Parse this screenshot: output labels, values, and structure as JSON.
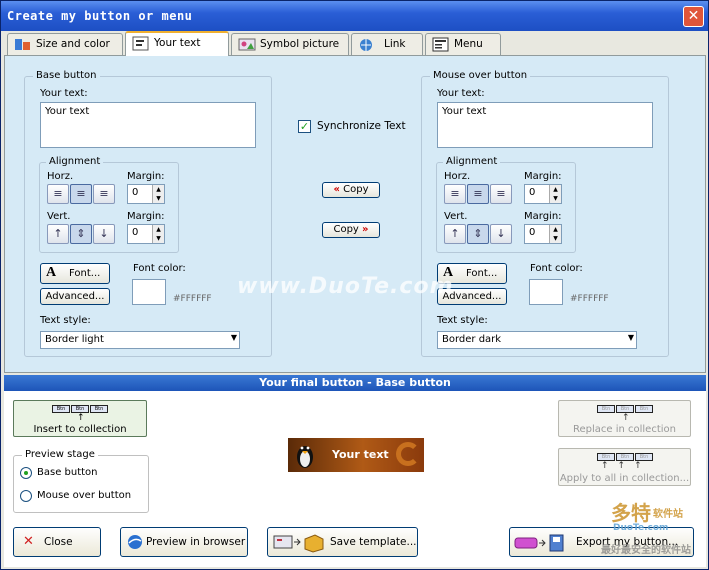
{
  "window": {
    "title": "Create my button or menu",
    "close": "✕"
  },
  "tabs": [
    {
      "label": "Size and color",
      "icon": "size-color-icon"
    },
    {
      "label": "Your text",
      "icon": "text-icon",
      "active": true
    },
    {
      "label": "Symbol picture",
      "icon": "picture-icon"
    },
    {
      "label": "Link",
      "icon": "link-icon"
    },
    {
      "label": "Menu",
      "icon": "menu-icon"
    }
  ],
  "base": {
    "group": "Base button",
    "your_text_label": "Your text:",
    "your_text": "Your text",
    "alignment": "Alignment",
    "horz": "Horz.",
    "vert": "Vert.",
    "margin1_label": "Margin:",
    "margin1": "0",
    "margin2_label": "Margin:",
    "margin2": "0",
    "font_btn": "Font...",
    "advanced_btn": "Advanced...",
    "font_color_label": "Font color:",
    "font_color_hex": "#FFFFFF",
    "text_style_label": "Text style:",
    "text_style": "Border light"
  },
  "mouse": {
    "group": "Mouse over button",
    "your_text_label": "Your text:",
    "your_text": "Your text",
    "alignment": "Alignment",
    "horz": "Horz.",
    "vert": "Vert.",
    "margin1_label": "Margin:",
    "margin1": "0",
    "margin2_label": "Margin:",
    "margin2": "0",
    "font_btn": "Font...",
    "advanced_btn": "Advanced...",
    "font_color_label": "Font color:",
    "font_color_hex": "#FFFFFF",
    "text_style_label": "Text style:",
    "text_style": "Border dark"
  },
  "middle": {
    "sync_label": "Synchronize Text",
    "sync_checked": true,
    "copy_left": "Copy",
    "copy_right": "Copy"
  },
  "final": {
    "header": "Your final button - Base button",
    "insert": "Insert to collection",
    "replace": "Replace in collection",
    "apply_all": "Apply to all in collection...",
    "preview_stage": "Preview stage",
    "radio_base": "Base button",
    "radio_mouse": "Mouse over button",
    "preview_text": "Your text",
    "mini_label": "Btn"
  },
  "footer": {
    "close": "Close",
    "preview": "Preview in browser",
    "save": "Save template...",
    "export": "Export my button..."
  },
  "watermarks": {
    "duote": "www.DuoTe.com",
    "site_cn": "多特",
    "site_cn_sub": "软件站",
    "site_url": "DuoTe.com",
    "site_tag": "最好最安全的软件站"
  },
  "colors": {
    "accent": "#2a5ed6",
    "panel": "#d6eaf6",
    "active_tab": "#f0b030"
  }
}
